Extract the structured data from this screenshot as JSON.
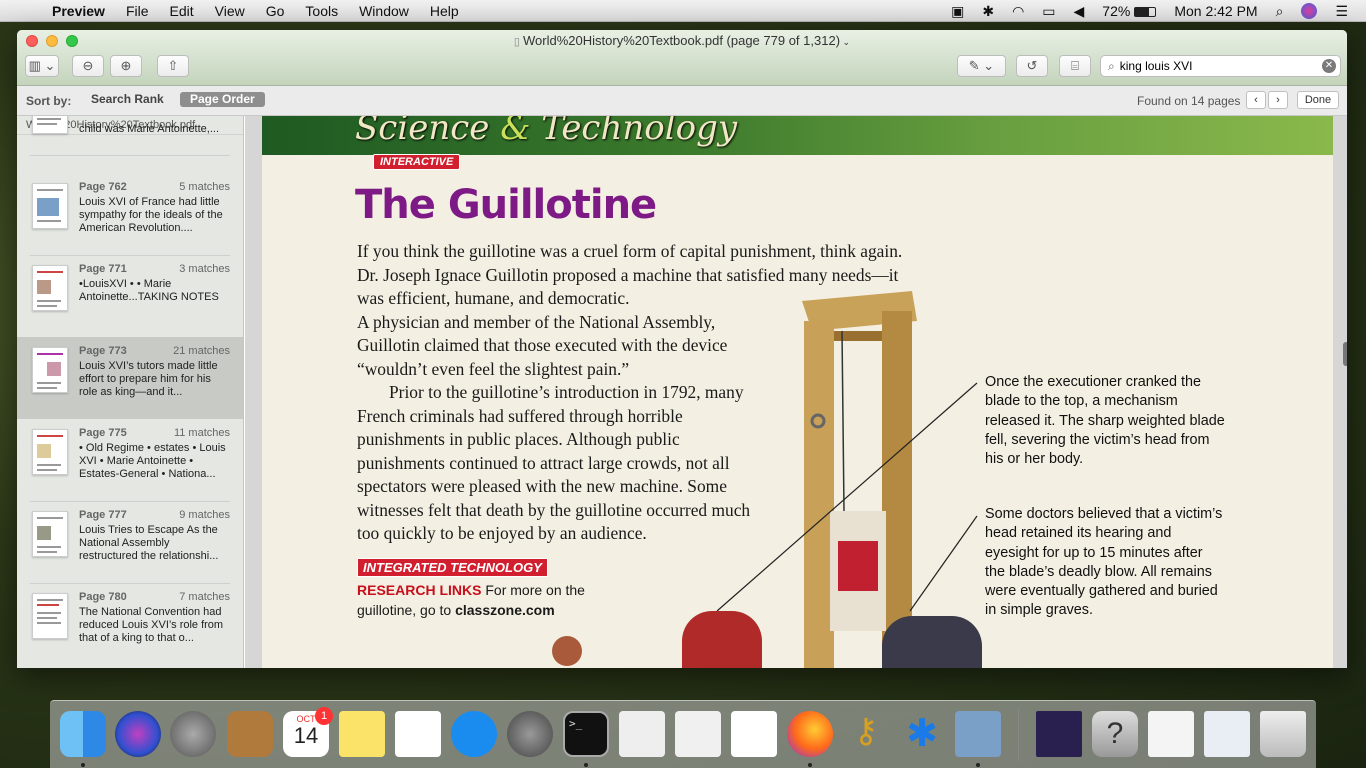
{
  "menubar": {
    "app": "Preview",
    "items": [
      "File",
      "Edit",
      "View",
      "Go",
      "Tools",
      "Window",
      "Help"
    ],
    "battery": "72%",
    "clock": "Mon 2:42 PM"
  },
  "window": {
    "title": "World%20History%20Textbook.pdf (page 779 of 1,312)",
    "search_value": "king louis XVI"
  },
  "sortbar": {
    "label": "Sort by:",
    "search_rank": "Search Rank",
    "page_order": "Page Order",
    "found": "Found on 14 pages",
    "done": "Done"
  },
  "sidebar": {
    "filename": "World%20History%20Textbook.pdf",
    "partial": "child was Marie Antoinette,...",
    "results": [
      {
        "page": "Page 762",
        "matches": "5 matches",
        "desc": "Louis XVI of France had little sympathy for the ideals of the American Revolution...."
      },
      {
        "page": "Page 771",
        "matches": "3 matches",
        "desc": "•LouisXVI • • Marie Antoinette...TAKING NOTES"
      },
      {
        "page": "Page 773",
        "matches": "21 matches",
        "desc": "Louis XVI’s tutors made little effort to prepare him for his role as king—and it..."
      },
      {
        "page": "Page 775",
        "matches": "11 matches",
        "desc": "• Old Regime • estates • Louis XVI • Marie Antoinette • Estates-General • Nationa..."
      },
      {
        "page": "Page 777",
        "matches": "9 matches",
        "desc": "Louis Tries to Escape As the National Assembly restructured the relationshi..."
      },
      {
        "page": "Page 780",
        "matches": "7 matches",
        "desc": "The National Convention had reduced Louis XVI’s role from that of a king to that o..."
      }
    ]
  },
  "page": {
    "banner_left": "Science ",
    "banner_amp": "&",
    "banner_right": " Technology",
    "interactive": "INTERACTIVE",
    "heading": "The Guillotine",
    "para1": "If you think the guillotine was a cruel form of capital punishment, think again. Dr. Joseph Ignace Guillotin proposed a machine that satisfied many needs—it was efficient, humane, and democratic.",
    "para2": "A physician and member of the National Assembly, Guillotin claimed that those executed with the device “wouldn’t even feel the slightest pain.”",
    "para3": "Prior to the guillotine’s introduction in 1792, many French criminals had suffered through horrible punishments in public places. Although public punishments continued to attract large crowds, not all spectators were pleased with the new machine. Some witnesses felt that death by the guillotine occurred much too quickly to be enjoyed by an audience.",
    "integrated": "INTEGRATED TECHNOLOGY",
    "research_label": "RESEARCH LINKS",
    "research_text": " For more on the guillotine, go to ",
    "research_link": "classzone.com",
    "caption1": "Once the executioner cranked the blade to the top, a mechanism released it. The sharp weighted blade fell, severing the victim’s head from his or her body.",
    "caption2": "Some doctors believed that a victim’s head retained its hearing and eyesight for up to 15 minutes after the blade’s deadly blow. All remains were eventually gathered and buried in simple graves."
  },
  "dock": {
    "calendar_month": "OCT",
    "calendar_day": "14",
    "calendar_badge": "1"
  }
}
